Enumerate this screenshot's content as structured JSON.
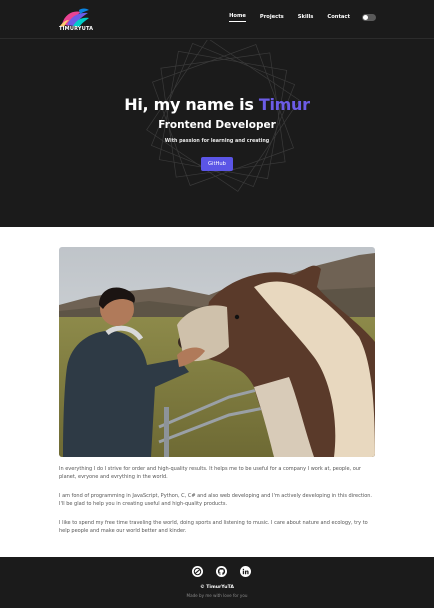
{
  "brand": {
    "name": "TIMURYUTA"
  },
  "nav": {
    "items": [
      {
        "label": "Home",
        "active": true
      },
      {
        "label": "Projects",
        "active": false
      },
      {
        "label": "Skills",
        "active": false
      },
      {
        "label": "Contact",
        "active": false
      }
    ],
    "theme_toggle": "dark-mode-toggle-icon"
  },
  "hero": {
    "greeting": "Hi, my name is ",
    "name": "Timur",
    "name_color": "#6c5ce7",
    "role": "Frontend Developer",
    "tagline": "With passion for learning and creating",
    "button_label": "GitHub",
    "button_color": "#5b55e6"
  },
  "about": {
    "photo": "portrait-with-horse-image",
    "paragraphs": [
      "In everything I do I strive for order and high-quality results. It helps me to be useful for a company I work at, people, our planet, evryone and evrything in the world.",
      "I am fond of programming in JavaScript, Python, C, C# and also web developing and I'm actively developing in this direction. I'll be glad to help you in creating useful and high-quality products.",
      "I like to spend my free time traveling the world, doing sports and listening to music. I care about nature and ecology, try to help people and make our world better and kinder."
    ]
  },
  "footer": {
    "socials": [
      "codewars-icon",
      "github-icon",
      "linkedin-icon"
    ],
    "copyright": "© TimurYuTA",
    "made_by": "Made by me with love for you"
  }
}
